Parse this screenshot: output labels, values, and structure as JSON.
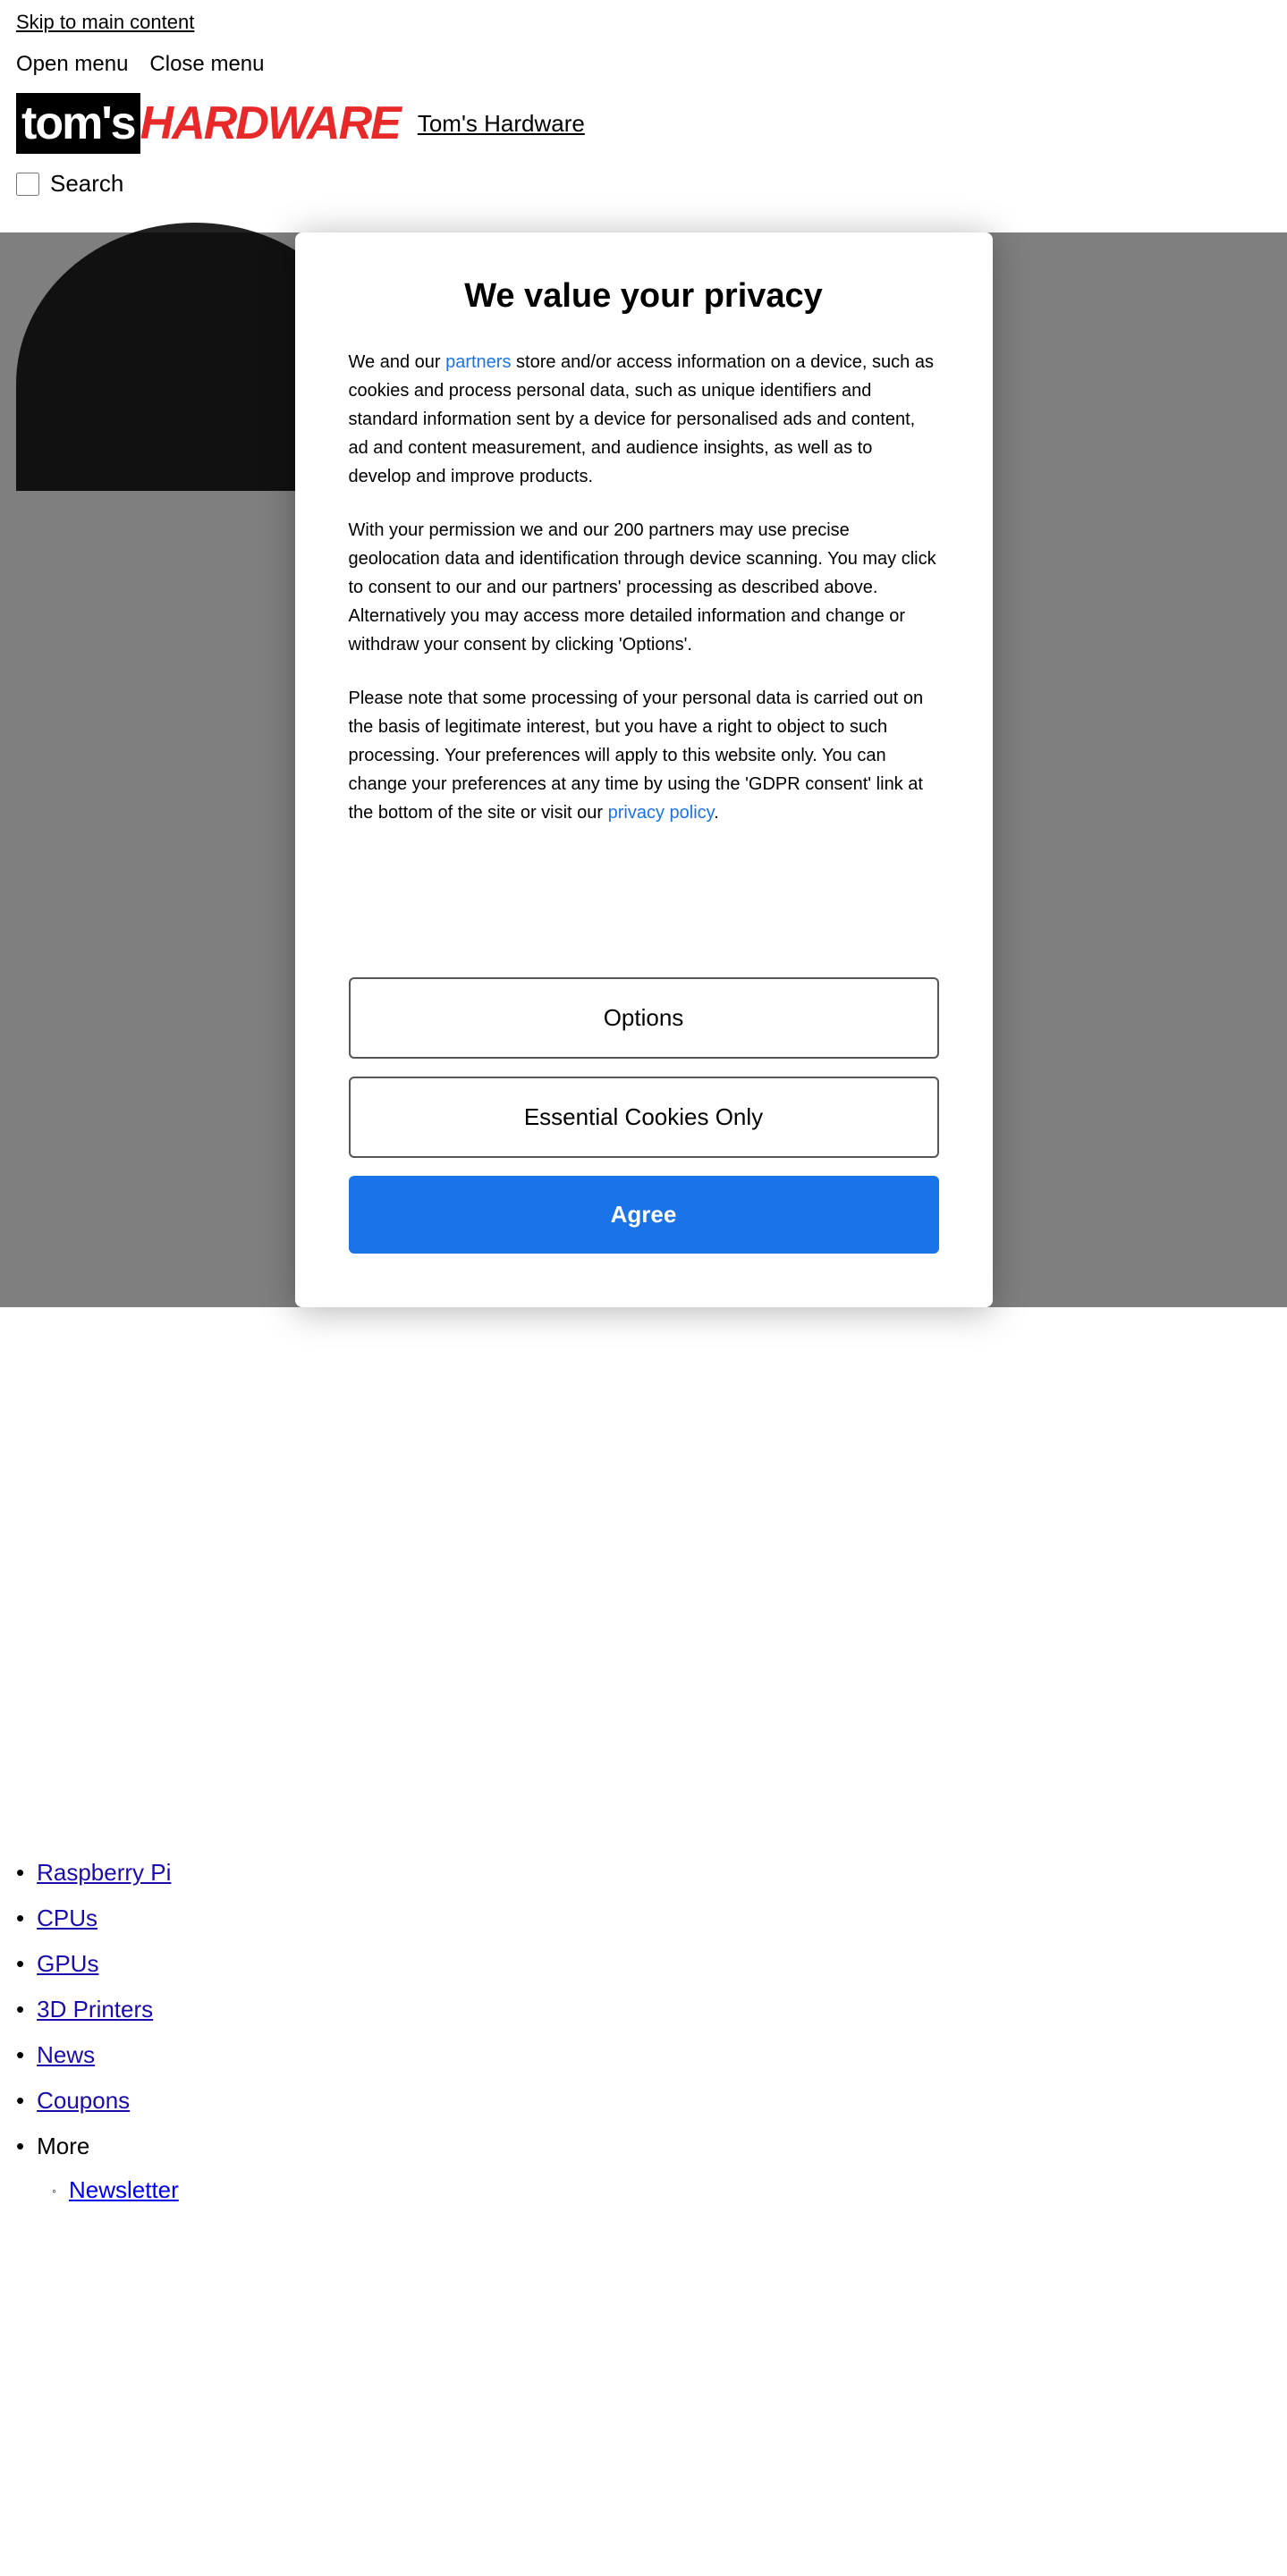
{
  "skipLink": {
    "label": "Skip to main content"
  },
  "header": {
    "openMenu": "Open menu",
    "closeMenu": "Close menu",
    "brandLogoToms": "tom's",
    "brandLogoHardware": "HARDWARE",
    "brandNameText": "Tom's Hardware",
    "searchLabel": "Search"
  },
  "modal": {
    "title": "We value your privacy",
    "paragraph1_prefix": "We and our ",
    "partners_link": "partners",
    "paragraph1_suffix": " store and/or access information on a device, such as cookies and process personal data, such as unique identifiers and standard information sent by a device for personalised ads and content, ad and content measurement, and audience insights, as well as to develop and improve products.",
    "paragraph2": "With your permission we and our 200 partners may use precise geolocation data and identification through device scanning. You may click to consent to our and our partners' processing as described above. Alternatively you may access more detailed information and change or withdraw your consent by clicking 'Options'.",
    "paragraph3_prefix": "Please note that some processing of your personal data is carried out on the basis of legitimate interest, but you have a right to object to such processing. Your preferences will apply to this website only. You can change your preferences at any time by using the 'GDPR consent' link at the bottom of the site or visit our ",
    "privacy_link": "privacy policy",
    "paragraph3_suffix": ".",
    "btn_options": "Options",
    "btn_essential": "Essential Cookies Only",
    "btn_agree": "Agree"
  },
  "nav": {
    "items": [
      {
        "label": "Raspberry Pi",
        "href": "#",
        "bullet": "•"
      },
      {
        "label": "CPUs",
        "href": "#",
        "bullet": "•"
      },
      {
        "label": "GPUs",
        "href": "#",
        "bullet": "•"
      },
      {
        "label": "3D Printers",
        "href": "#",
        "bullet": "•"
      },
      {
        "label": "News",
        "href": "#",
        "bullet": "•"
      },
      {
        "label": "Coupons",
        "href": "#",
        "bullet": "•"
      }
    ],
    "moreLabel": "More",
    "subItems": [
      {
        "label": "Newsletter",
        "href": "#",
        "bullet": "◦"
      }
    ]
  },
  "colors": {
    "accent_blue": "#1a73e8",
    "brand_red": "#e8292a",
    "text_link": "#1a0dab"
  }
}
